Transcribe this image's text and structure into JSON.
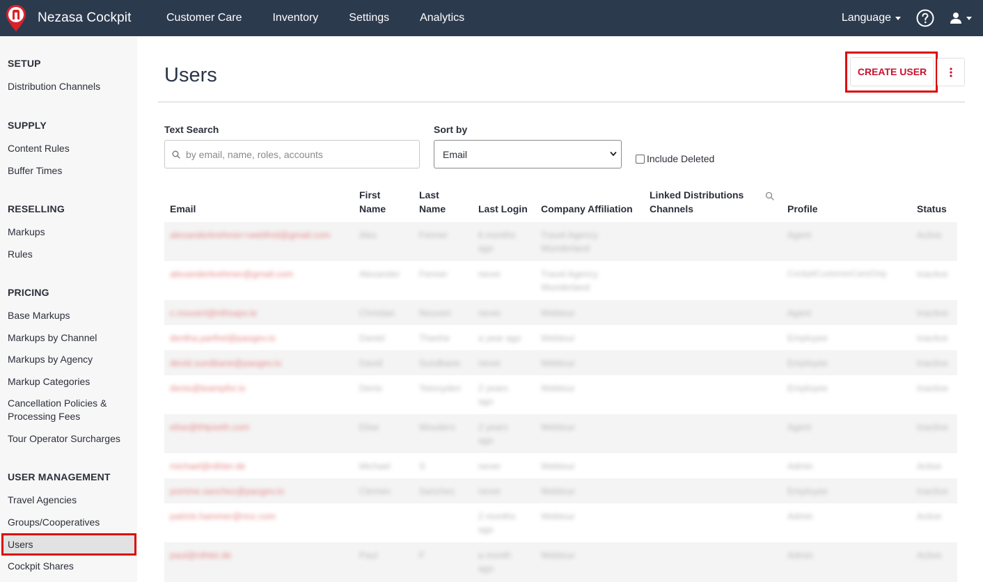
{
  "navbar": {
    "brand": "Nezasa Cockpit",
    "items": [
      "Customer Care",
      "Inventory",
      "Settings",
      "Analytics"
    ],
    "language": "Language"
  },
  "sidebar": {
    "sections": [
      {
        "heading": "SETUP",
        "items": [
          "Distribution Channels"
        ]
      },
      {
        "heading": "SUPPLY",
        "items": [
          "Content Rules",
          "Buffer Times"
        ]
      },
      {
        "heading": "RESELLING",
        "items": [
          "Markups",
          "Rules"
        ]
      },
      {
        "heading": "PRICING",
        "items": [
          "Base Markups",
          "Markups by Channel",
          "Markups by Agency",
          "Markup Categories",
          "Cancellation Policies & Processing Fees",
          "Tour Operator Surcharges"
        ]
      },
      {
        "heading": "USER MANAGEMENT",
        "items": [
          "Travel Agencies",
          "Groups/Cooperatives",
          "Users",
          "Cockpit Shares"
        ]
      }
    ],
    "active_item": "Users"
  },
  "main": {
    "title": "Users",
    "create_button": "CREATE USER",
    "filters": {
      "text_search_label": "Text Search",
      "text_search_placeholder": "by email, name, roles, accounts",
      "sort_label": "Sort by",
      "sort_value": "Email",
      "include_deleted": "Include Deleted"
    },
    "table": {
      "headers": {
        "email": "Email",
        "first_name_1": "First",
        "first_name_2": "Name",
        "last_name_1": "Last",
        "last_name_2": "Name",
        "last_login": "Last Login",
        "company": "Company Affiliation",
        "linked_1": "Linked Distributions",
        "linked_2": "Channels",
        "profile": "Profile",
        "status": "Status"
      },
      "rows": [
        {
          "email": "alexanderkrehmer+webfmd@gmail.com",
          "first": "Alex",
          "last": "Fenner",
          "login1": "6 months",
          "login2": "ago",
          "company1": "Travel Agency",
          "company2": "Wunderland",
          "profile": "Agent",
          "status": "Active"
        },
        {
          "email": "alexanderkrehmer@gmail.com",
          "first": "Alexander",
          "last": "Fenner",
          "login1": "never",
          "login2": "",
          "company1": "Travel Agency",
          "company2": "Wunderland",
          "profile": "CockpitCustomerCareOnly",
          "status": "Inactive"
        },
        {
          "email": "c.nouvert@nthsapv.ie",
          "first": "Christian",
          "last": "Nouvert",
          "login1": "never",
          "login2": "",
          "company1": "Webtour",
          "company2": "",
          "profile": "Agent",
          "status": "Inactive"
        },
        {
          "email": "dentha.parthel@paogev.io",
          "first": "Daniel",
          "last": "Thanhe",
          "login1": "a year ago",
          "login2": "",
          "company1": "Webtour",
          "company2": "",
          "profile": "Employee",
          "status": "Inactive"
        },
        {
          "email": "devid.sundbane@paogev.io",
          "first": "David",
          "last": "Sundbane",
          "login1": "never",
          "login2": "",
          "company1": "Webtour",
          "company2": "",
          "profile": "Employee",
          "status": "Inactive"
        },
        {
          "email": "denis@teampfor.io",
          "first": "Denis",
          "last": "Tetonyden",
          "login1": "2 years",
          "login2": "ago",
          "company1": "Webtour",
          "company2": "",
          "profile": "Employee",
          "status": "Inactive"
        },
        {
          "email": "elise@thtpseth.com",
          "first": "Elise",
          "last": "Wouders",
          "login1": "2 years",
          "login2": "ago",
          "company1": "Webtour",
          "company2": "",
          "profile": "Agent",
          "status": "Inactive"
        },
        {
          "email": "michael@nthter.de",
          "first": "Michael",
          "last": "S",
          "login1": "never",
          "login2": "",
          "company1": "Webtour",
          "company2": "",
          "profile": "Admin",
          "status": "Active"
        },
        {
          "email": "pomme.sanchez@paogev.io",
          "first": "Clemen",
          "last": "Sanches",
          "login1": "never",
          "login2": "",
          "company1": "Webtour",
          "company2": "",
          "profile": "Employee",
          "status": "Inactive"
        },
        {
          "email": "patrick.hammer@nnz.com",
          "first": "",
          "last": "",
          "login1": "2 months",
          "login2": "ago",
          "company1": "Webtour",
          "company2": "",
          "profile": "Admin",
          "status": "Active"
        },
        {
          "email": "paul@nthter.de",
          "first": "Paul",
          "last": "F",
          "login1": "a month",
          "login2": "ago",
          "company1": "Webtour",
          "company2": "",
          "profile": "Admin",
          "status": "Active"
        }
      ]
    }
  },
  "colors": {
    "navbar_bg": "#2c3a4e",
    "accent_red": "#c8102e",
    "highlight_red": "#dc0a0a"
  },
  "icons": [
    "brand-logo-icon",
    "help-icon",
    "user-icon",
    "search-icon",
    "chevron-down-icon",
    "more-vertical-icon"
  ]
}
